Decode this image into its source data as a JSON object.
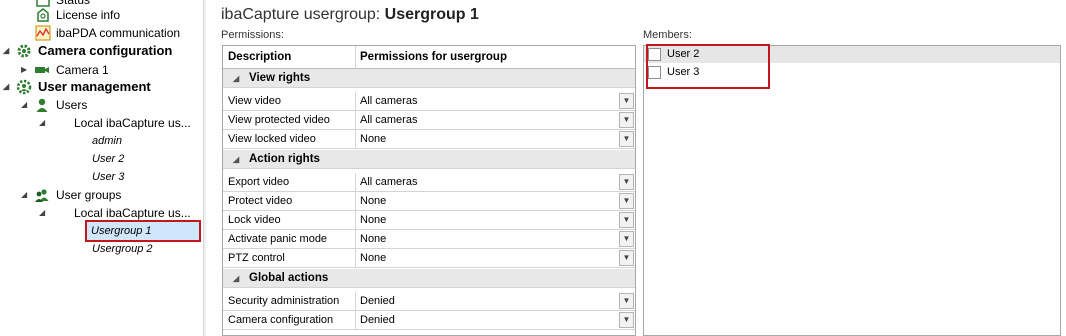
{
  "tree": {
    "items": [
      {
        "label": "Status",
        "icon": "status-icon",
        "level": 2
      },
      {
        "label": "License info",
        "icon": "license-icon",
        "level": 2
      },
      {
        "label": "ibaPDA communication",
        "icon": "pda-chart-icon",
        "level": 2
      },
      {
        "label": "Camera configuration",
        "icon": "gear-icon",
        "level": 1,
        "bold": true
      },
      {
        "label": "Camera 1",
        "icon": "camera-icon",
        "level": 2
      },
      {
        "label": "User management",
        "icon": "user-gear-icon",
        "level": 1,
        "bold": true
      },
      {
        "label": "Users",
        "icon": "user-icon",
        "level": 2
      },
      {
        "label": "Local ibaCapture us...",
        "level": 3
      },
      {
        "label": "admin",
        "level": 4,
        "italic": true
      },
      {
        "label": "User 2",
        "level": 4,
        "italic": true
      },
      {
        "label": "User 3",
        "level": 4,
        "italic": true
      },
      {
        "label": "User groups",
        "icon": "user-group-icon",
        "level": 2
      },
      {
        "label": "Local ibaCapture us...",
        "level": 3
      },
      {
        "label": "Usergroup 1",
        "level": 4,
        "italic": true,
        "selected": true
      },
      {
        "label": "Usergroup 2",
        "level": 4,
        "italic": true
      }
    ]
  },
  "header": {
    "title_prefix": "ibaCapture usergroup: ",
    "title_name": "Usergroup 1"
  },
  "permissions": {
    "label": "Permissions:",
    "col_description": "Description",
    "col_permissions": "Permissions for usergroup",
    "sections": [
      {
        "title": "View rights",
        "rows": [
          {
            "desc": "View video",
            "value": "All cameras"
          },
          {
            "desc": "View protected video",
            "value": "All cameras"
          },
          {
            "desc": "View locked video",
            "value": "None"
          }
        ]
      },
      {
        "title": "Action rights",
        "rows": [
          {
            "desc": "Export video",
            "value": "All cameras"
          },
          {
            "desc": "Protect video",
            "value": "None"
          },
          {
            "desc": "Lock video",
            "value": "None"
          },
          {
            "desc": "Activate panic mode",
            "value": "None"
          },
          {
            "desc": "PTZ control",
            "value": "None"
          }
        ]
      },
      {
        "title": "Global actions",
        "rows": [
          {
            "desc": "Security administration",
            "value": "Denied"
          },
          {
            "desc": "Camera configuration",
            "value": "Denied"
          }
        ]
      }
    ]
  },
  "members": {
    "label": "Members:",
    "items": [
      {
        "label": "User 2",
        "checked": false
      },
      {
        "label": "User 3",
        "checked": false
      }
    ]
  },
  "colors": {
    "highlight_border": "#c0181f",
    "selection_bg": "#cfe6fb",
    "section_bg": "#e8e8e8",
    "icon_green": "#2e7d32"
  }
}
